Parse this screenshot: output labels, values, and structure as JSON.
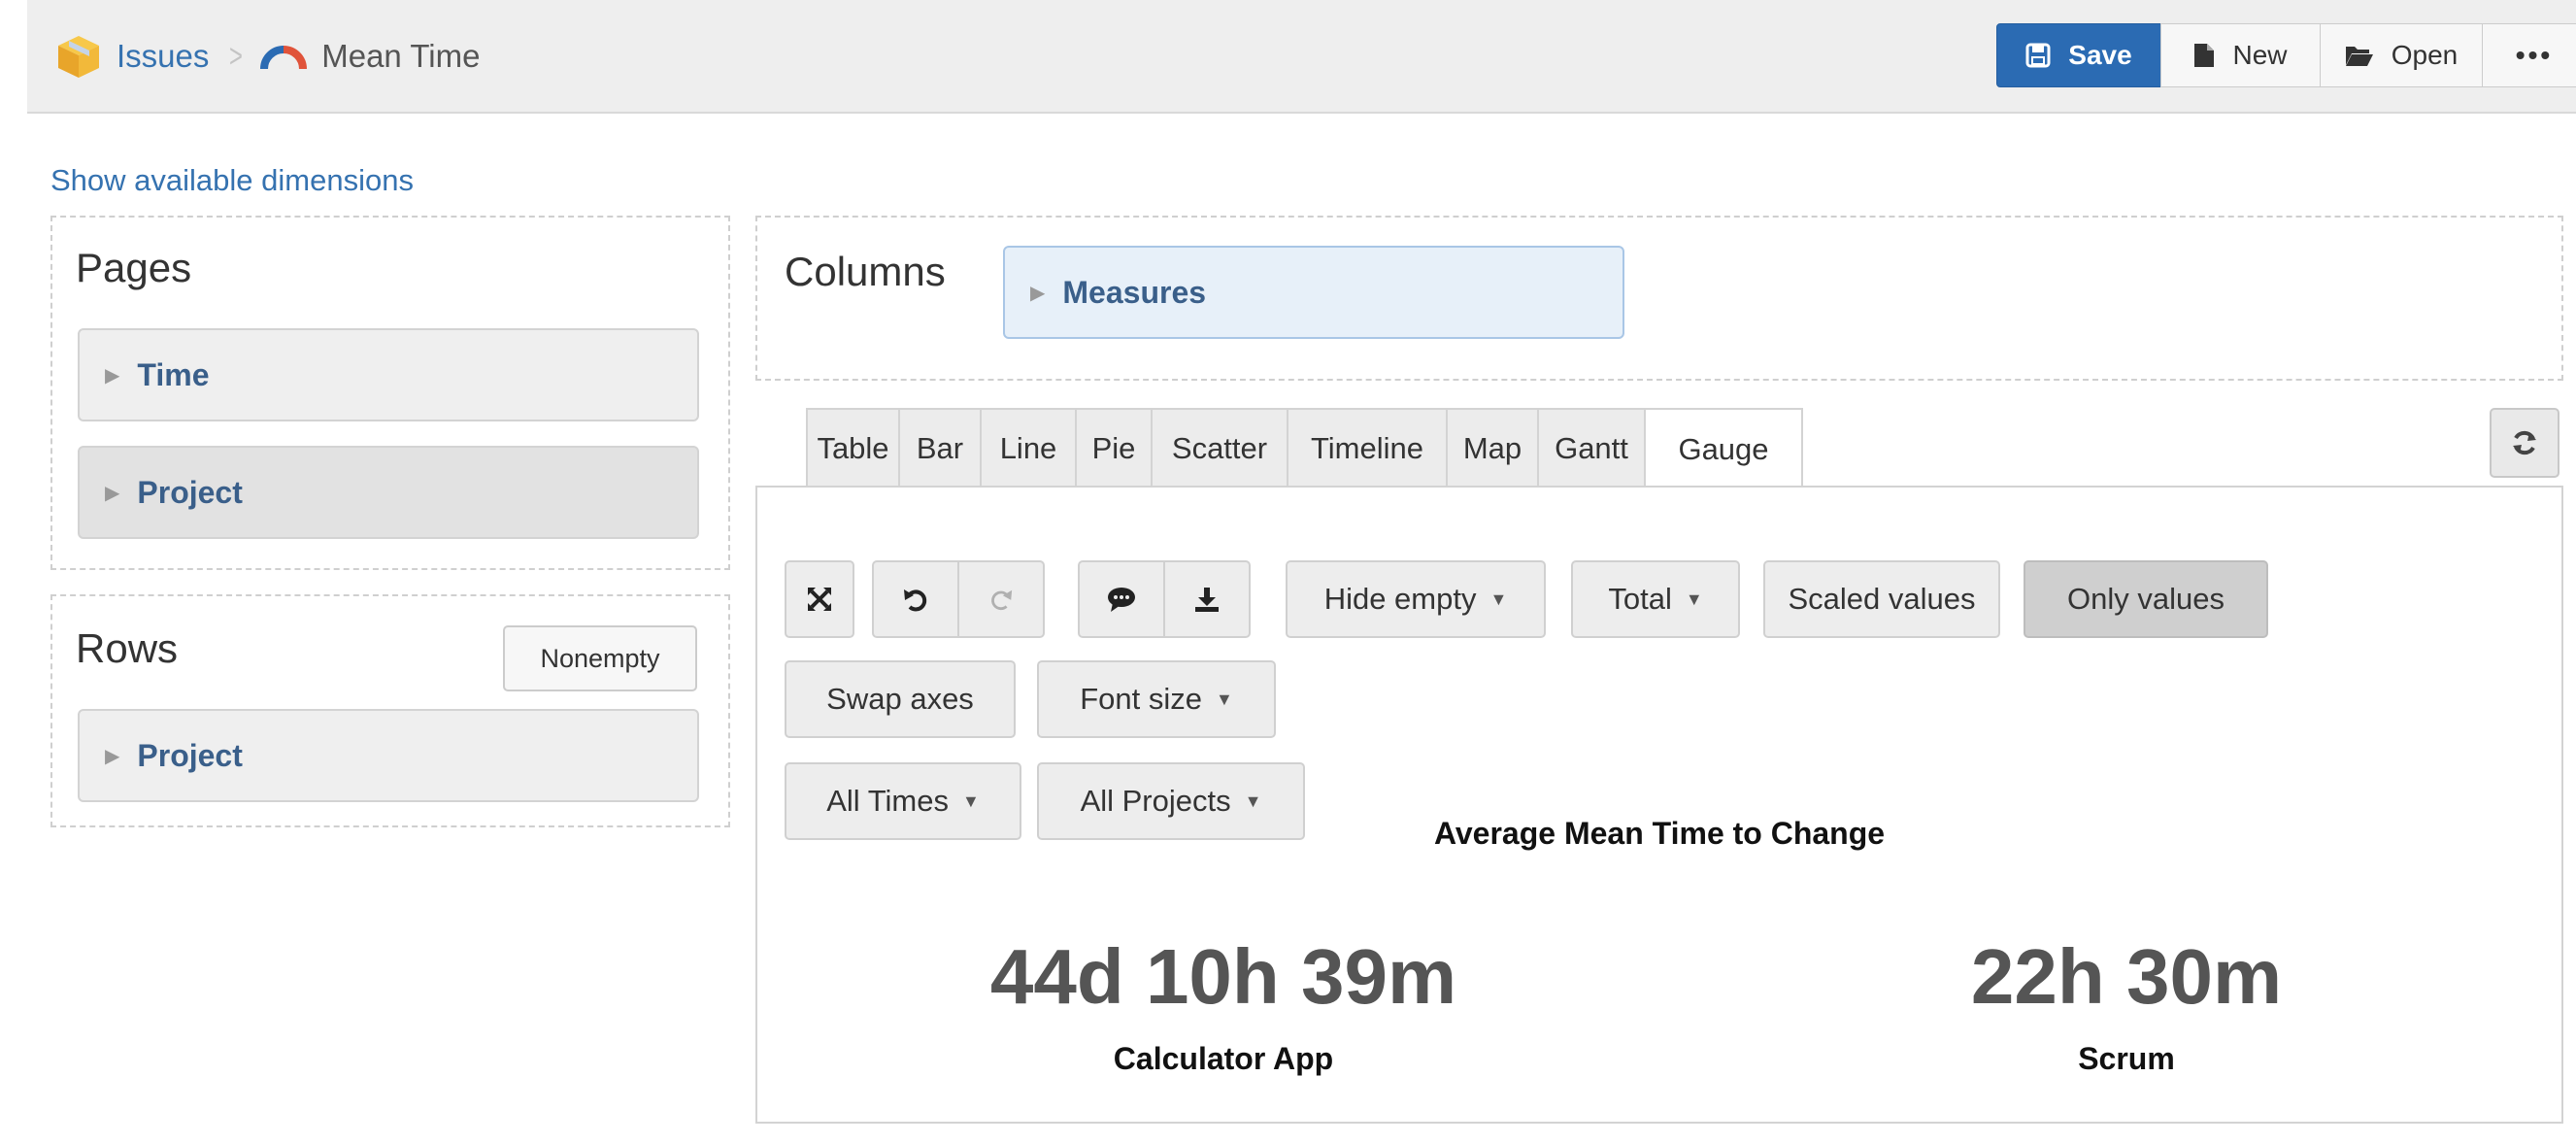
{
  "header": {
    "breadcrumb_root": "Issues",
    "breadcrumb_current": "Mean Time",
    "toolbar": {
      "save_label": "Save",
      "new_label": "New",
      "open_label": "Open",
      "more_label": "•••"
    }
  },
  "show_dimensions_link": "Show available dimensions",
  "pages": {
    "title": "Pages",
    "items": [
      {
        "label": "Time"
      },
      {
        "label": "Project"
      }
    ]
  },
  "rows": {
    "title": "Rows",
    "nonempty_label": "Nonempty",
    "items": [
      {
        "label": "Project"
      }
    ]
  },
  "columns": {
    "title": "Columns",
    "items": [
      {
        "label": "Measures"
      }
    ]
  },
  "tabs": [
    {
      "label": "Table"
    },
    {
      "label": "Bar"
    },
    {
      "label": "Line"
    },
    {
      "label": "Pie"
    },
    {
      "label": "Scatter"
    },
    {
      "label": "Timeline"
    },
    {
      "label": "Map"
    },
    {
      "label": "Gantt"
    },
    {
      "label": "Gauge",
      "active": true
    }
  ],
  "controls": {
    "hide_empty": "Hide empty",
    "total": "Total",
    "scaled_values": "Scaled values",
    "only_values": "Only values",
    "swap_axes": "Swap axes",
    "font_size": "Font size",
    "all_times": "All Times",
    "all_projects": "All Projects"
  },
  "icons": {
    "fullscreen": "fullscreen-icon",
    "undo": "undo-icon",
    "redo": "redo-icon",
    "comment": "comment-icon",
    "download": "download-icon",
    "refresh": "refresh-icon"
  },
  "chart_data": {
    "type": "gauge",
    "title": "Average Mean Time to Change",
    "series": [
      {
        "name": "Calculator App",
        "display": "44d 10h 39m",
        "minutes": 63999
      },
      {
        "name": "Scrum",
        "display": "22h 30m",
        "minutes": 1350
      }
    ]
  },
  "colors": {
    "primary": "#2b6bb3",
    "link": "#3572b0",
    "dimension_label": "#3a5f8a",
    "gauge_value": "#555555"
  }
}
